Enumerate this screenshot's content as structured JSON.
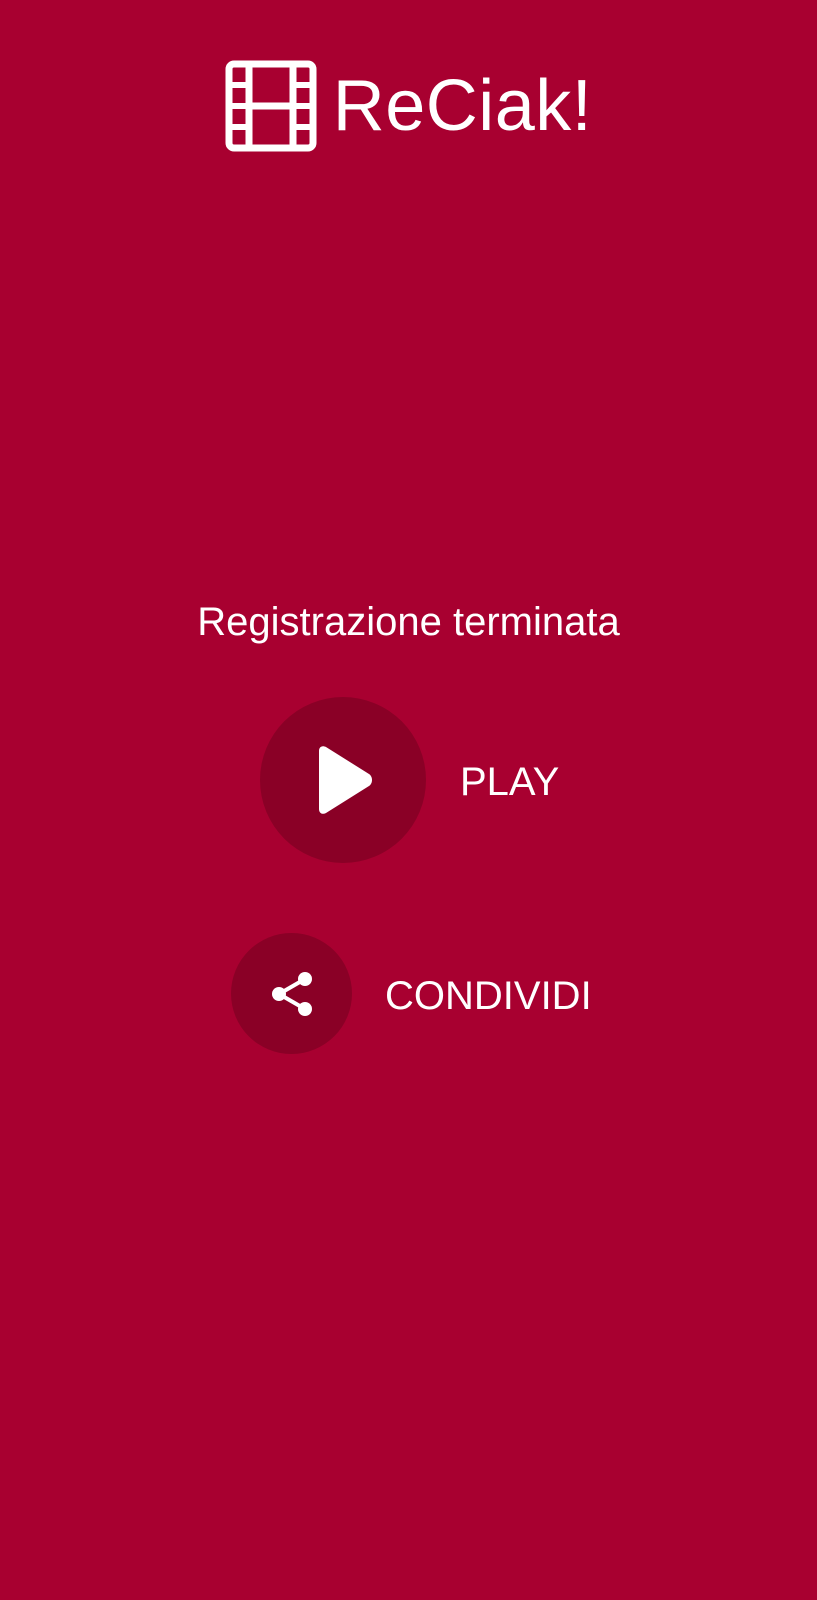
{
  "app": {
    "title": "ReCiak!",
    "logo_icon": "film-strip-icon"
  },
  "status": {
    "message": "Registrazione terminata"
  },
  "actions": {
    "play": {
      "label": "PLAY",
      "icon": "play-icon"
    },
    "share": {
      "label": "CONDIVIDI",
      "icon": "share-icon"
    }
  },
  "colors": {
    "background": "#a80030",
    "button_circle": "#8a0026",
    "foreground": "#ffffff"
  }
}
